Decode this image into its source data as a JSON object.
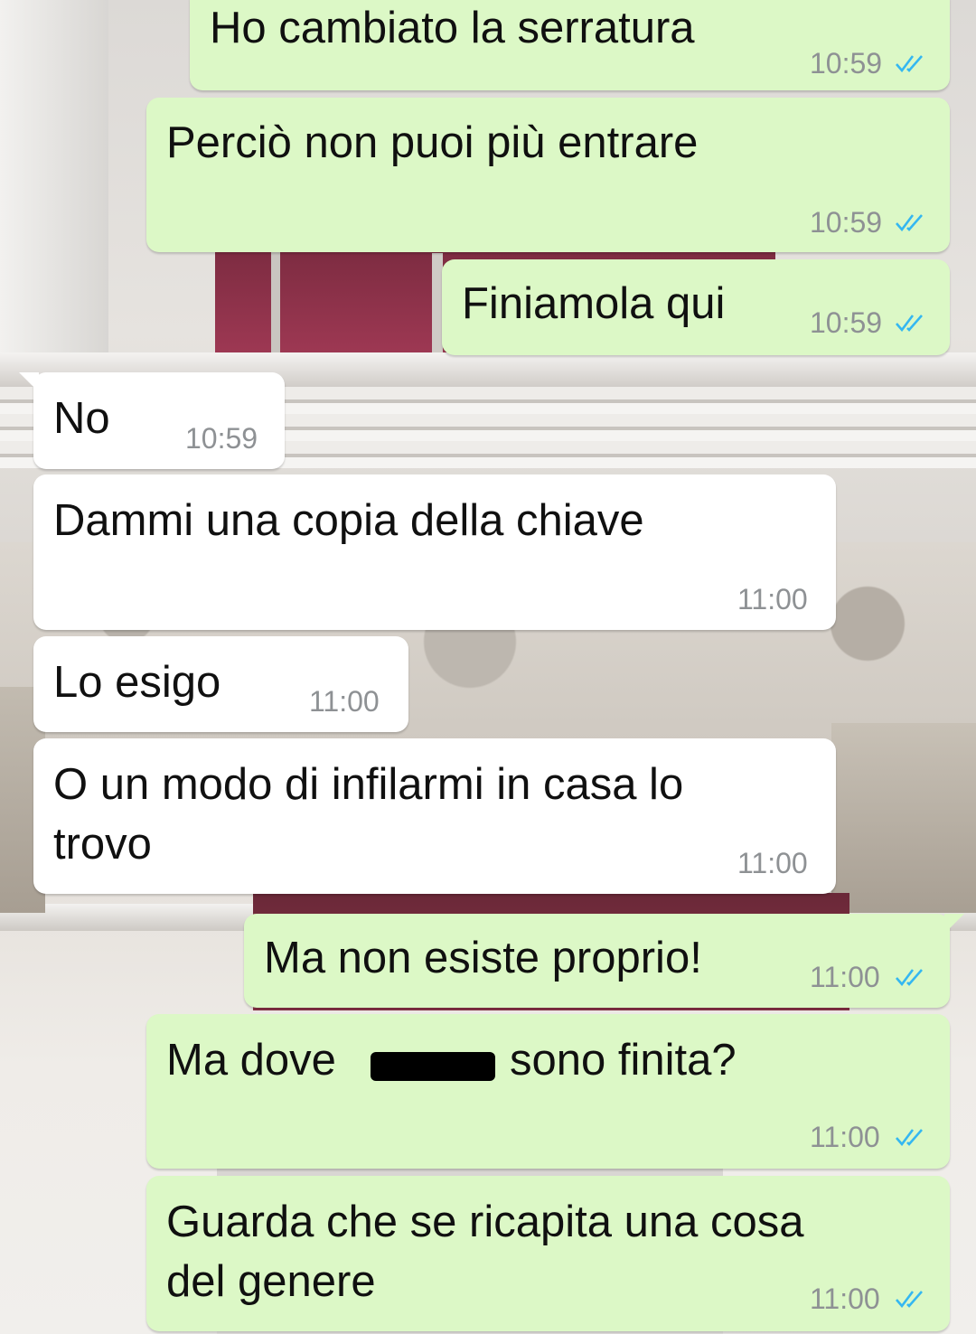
{
  "chat": {
    "messages": [
      {
        "id": "m1",
        "direction": "outgoing",
        "text": "Ho cambiato la serratura",
        "time": "10:59",
        "status": "read"
      },
      {
        "id": "m2",
        "direction": "outgoing",
        "text": "Perciò non puoi più entrare",
        "time": "10:59",
        "status": "read"
      },
      {
        "id": "m3",
        "direction": "outgoing",
        "text": "Finiamola qui",
        "time": "10:59",
        "status": "read"
      },
      {
        "id": "m4",
        "direction": "incoming",
        "text": "No",
        "time": "10:59"
      },
      {
        "id": "m5",
        "direction": "incoming",
        "text": "Dammi una copia della chiave",
        "time": "11:00"
      },
      {
        "id": "m6",
        "direction": "incoming",
        "text": "Lo esigo",
        "time": "11:00"
      },
      {
        "id": "m7",
        "direction": "incoming",
        "text_line1": "O un modo di infilarmi in casa lo",
        "text_line2": "trovo",
        "time": "11:00"
      },
      {
        "id": "m8",
        "direction": "outgoing",
        "text": "Ma non esiste proprio!",
        "time": "11:00",
        "status": "read"
      },
      {
        "id": "m9",
        "direction": "outgoing",
        "text_before": "Ma dove",
        "text_after": "sono finita?",
        "redacted": true,
        "time": "11:00",
        "status": "read"
      },
      {
        "id": "m10",
        "direction": "outgoing",
        "text_line1": "Guarda che se ricapita una cosa",
        "text_line2": "del genere",
        "time": "11:00",
        "status": "read"
      }
    ]
  },
  "colors": {
    "outgoing_bubble": "#dcf8c6",
    "incoming_bubble": "#ffffff",
    "timestamp": "#8e9194",
    "read_ticks": "#34b7f1"
  }
}
